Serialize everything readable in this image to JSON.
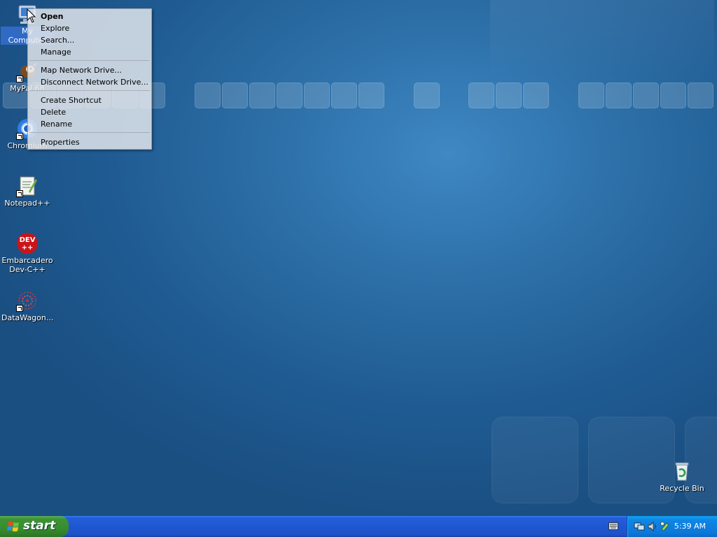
{
  "desktop": {
    "icons": [
      {
        "label": "My Computer",
        "icon": "my-computer-icon"
      },
      {
        "label": "MyPal 68",
        "icon": "mypal-icon"
      },
      {
        "label": "Chromium",
        "icon": "chromium-icon"
      },
      {
        "label": "Notepad++",
        "icon": "notepadpp-icon"
      },
      {
        "label": "Embarcadero Dev-C++",
        "icon": "devcpp-icon",
        "icon_text": "DEV\n++"
      },
      {
        "label": "DataWagon...",
        "icon": "datawagon-icon"
      },
      {
        "label": "Recycle Bin",
        "icon": "recycle-bin-icon"
      }
    ]
  },
  "context_menu": {
    "items": [
      {
        "label": "Open",
        "bold": true
      },
      {
        "label": "Explore"
      },
      {
        "label": "Search..."
      },
      {
        "label": "Manage"
      },
      {
        "label": "Map Network Drive..."
      },
      {
        "label": "Disconnect Network Drive..."
      },
      {
        "label": "Create Shortcut"
      },
      {
        "label": "Delete"
      },
      {
        "label": "Rename"
      },
      {
        "label": "Properties"
      }
    ]
  },
  "taskbar": {
    "start_label": "start",
    "clock": "5:39 AM",
    "tray_icons": [
      "network-icon",
      "audio-icon",
      "safely-remove-icon"
    ]
  },
  "colors": {
    "desktop_blue": "#2c6ea6",
    "taskbar_blue": "#245edb",
    "start_green": "#378c2f",
    "selection_blue": "#316ac5"
  }
}
